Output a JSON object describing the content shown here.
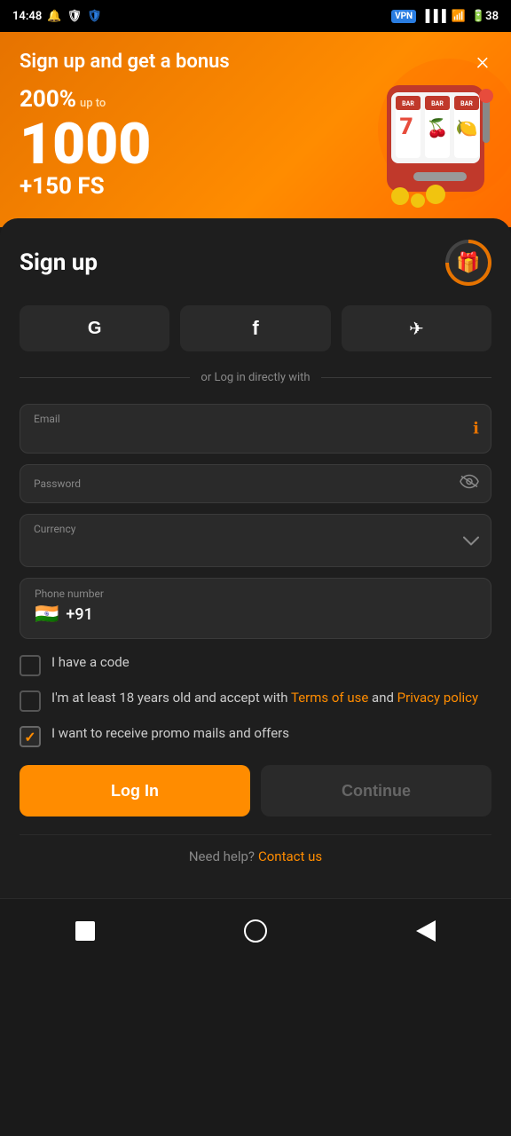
{
  "statusBar": {
    "time": "14:48",
    "vpn": "VPN"
  },
  "banner": {
    "title": "Sign up and get a bonus",
    "percent": "200%",
    "upto": "up to",
    "number": "1000",
    "fs": "+150 FS",
    "closeLabel": "×"
  },
  "form": {
    "title": "Sign up",
    "divider": "or Log in directly with",
    "emailLabel": "Email",
    "emailPlaceholder": "",
    "passwordLabel": "Password",
    "currencyLabel": "Currency",
    "phoneLabel": "Phone number",
    "phoneValue": "+91",
    "flagEmoji": "🇮🇳",
    "checkboxes": [
      {
        "id": "code",
        "label": "I have a code",
        "checked": false
      },
      {
        "id": "terms",
        "label_prefix": "I'm at least 18 years old and accept with ",
        "terms_link": "Terms of use",
        "label_middle": " and ",
        "privacy_link": "Privacy policy",
        "checked": false
      },
      {
        "id": "promo",
        "label": "I want to receive promo mails and offers",
        "checked": true
      }
    ],
    "loginBtn": "Log In",
    "continueBtn": "Continue"
  },
  "footer": {
    "helpText": "Need help?",
    "contactLink": "Contact us"
  },
  "socialButtons": [
    {
      "icon": "G",
      "name": "google"
    },
    {
      "icon": "f",
      "name": "facebook"
    },
    {
      "icon": "✈",
      "name": "telegram"
    }
  ]
}
